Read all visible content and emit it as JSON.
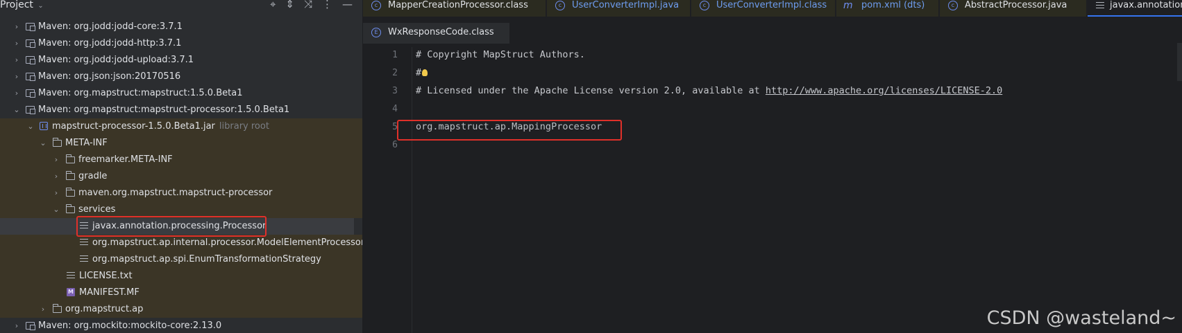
{
  "project": {
    "title": "Project",
    "tree": [
      {
        "label": "Maven: org.jodd:jodd-core:3.7.1",
        "icon": "library-icon",
        "arrow": "›"
      },
      {
        "label": "Maven: org.jodd:jodd-http:3.7.1",
        "icon": "library-icon",
        "arrow": "›"
      },
      {
        "label": "Maven: org.jodd:jodd-upload:3.7.1",
        "icon": "library-icon",
        "arrow": "›"
      },
      {
        "label": "Maven: org.json:json:20170516",
        "icon": "library-icon",
        "arrow": "›"
      },
      {
        "label": "Maven: org.mapstruct:mapstruct:1.5.0.Beta1",
        "icon": "library-icon",
        "arrow": "›"
      },
      {
        "label": "Maven: org.mapstruct:mapstruct-processor:1.5.0.Beta1",
        "icon": "library-icon",
        "arrow": "⌄"
      },
      {
        "label": "mapstruct-processor-1.5.0.Beta1.jar",
        "suffix": "library root",
        "icon": "jar-icon",
        "arrow": "⌄"
      },
      {
        "label": "META-INF",
        "icon": "folder-icon",
        "arrow": "⌄"
      },
      {
        "label": "freemarker.META-INF",
        "icon": "folder-icon",
        "arrow": "›"
      },
      {
        "label": "gradle",
        "icon": "folder-icon",
        "arrow": "›"
      },
      {
        "label": "maven.org.mapstruct.mapstruct-processor",
        "icon": "folder-icon",
        "arrow": "›"
      },
      {
        "label": "services",
        "icon": "folder-icon",
        "arrow": "⌄"
      },
      {
        "label": "javax.annotation.processing.Processor",
        "icon": "text-file-icon",
        "arrow": ""
      },
      {
        "label": "org.mapstruct.ap.internal.processor.ModelElementProcessor",
        "icon": "text-file-icon",
        "arrow": ""
      },
      {
        "label": "org.mapstruct.ap.spi.EnumTransformationStrategy",
        "icon": "text-file-icon",
        "arrow": ""
      },
      {
        "label": "LICENSE.txt",
        "icon": "text-file-icon",
        "arrow": ""
      },
      {
        "label": "MANIFEST.MF",
        "icon": "manifest-icon",
        "arrow": ""
      },
      {
        "label": "org.mapstruct.ap",
        "icon": "folder-icon",
        "arrow": "›"
      },
      {
        "label": "Maven: org.mockito:mockito-core:2.13.0",
        "icon": "library-icon",
        "arrow": "›"
      }
    ]
  },
  "editor": {
    "tabs_row1": [
      {
        "label": "MapperCreationProcessor.class",
        "icon": "class-icon"
      },
      {
        "label": "UserConverterImpl.java",
        "icon": "class-icon"
      },
      {
        "label": "UserConverterImpl.class",
        "icon": "class-icon"
      },
      {
        "label": "pom.xml (dts)",
        "icon": "maven-icon"
      },
      {
        "label": "AbstractProcessor.java",
        "icon": "class-icon"
      },
      {
        "label": "javax.annotation.processing.Processor",
        "icon": "text-file-icon"
      }
    ],
    "tabs_row2": [
      {
        "label": "WxResponseCode.class",
        "icon": "enum-icon"
      }
    ],
    "lines": [
      {
        "num": "1",
        "text": "# Copyright MapStruct Authors."
      },
      {
        "num": "2",
        "text": "#"
      },
      {
        "num": "3",
        "text": "# Licensed under the Apache License version 2.0, available at ",
        "link": "http://www.apache.org/licenses/LICENSE-2.0"
      },
      {
        "num": "4",
        "text": ""
      },
      {
        "num": "5",
        "text": "org.mapstruct.ap.MappingProcessor"
      },
      {
        "num": "6",
        "text": ""
      }
    ]
  },
  "watermark": "CSDN @wasteland~"
}
